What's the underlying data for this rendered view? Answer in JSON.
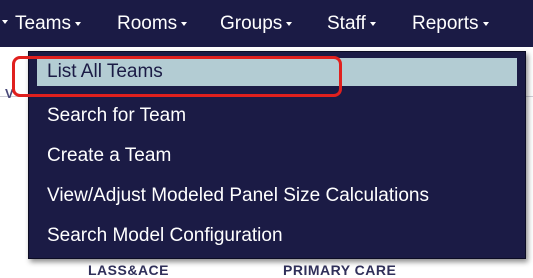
{
  "navbar": {
    "items": [
      {
        "label": "Teams"
      },
      {
        "label": "Rooms"
      },
      {
        "label": "Groups"
      },
      {
        "label": "Staff"
      },
      {
        "label": "Reports"
      }
    ]
  },
  "dropdown": {
    "items": [
      {
        "label": "List All Teams",
        "selected": true
      },
      {
        "label": "Search for Team"
      },
      {
        "label": "Create a Team"
      },
      {
        "label": "View/Adjust Modeled Panel Size Calculations"
      },
      {
        "label": "Search Model Configuration"
      }
    ]
  },
  "background": {
    "partial_text_left": "V",
    "partial_text_bottom_1": "LASS&ACE",
    "partial_text_bottom_2": "PRIMARY CARE"
  },
  "colors": {
    "nav_bg": "#1b1b45",
    "menu_text": "#ffffff",
    "selected_bg": "#b3ccd3",
    "highlight_ring": "#e0201e"
  }
}
